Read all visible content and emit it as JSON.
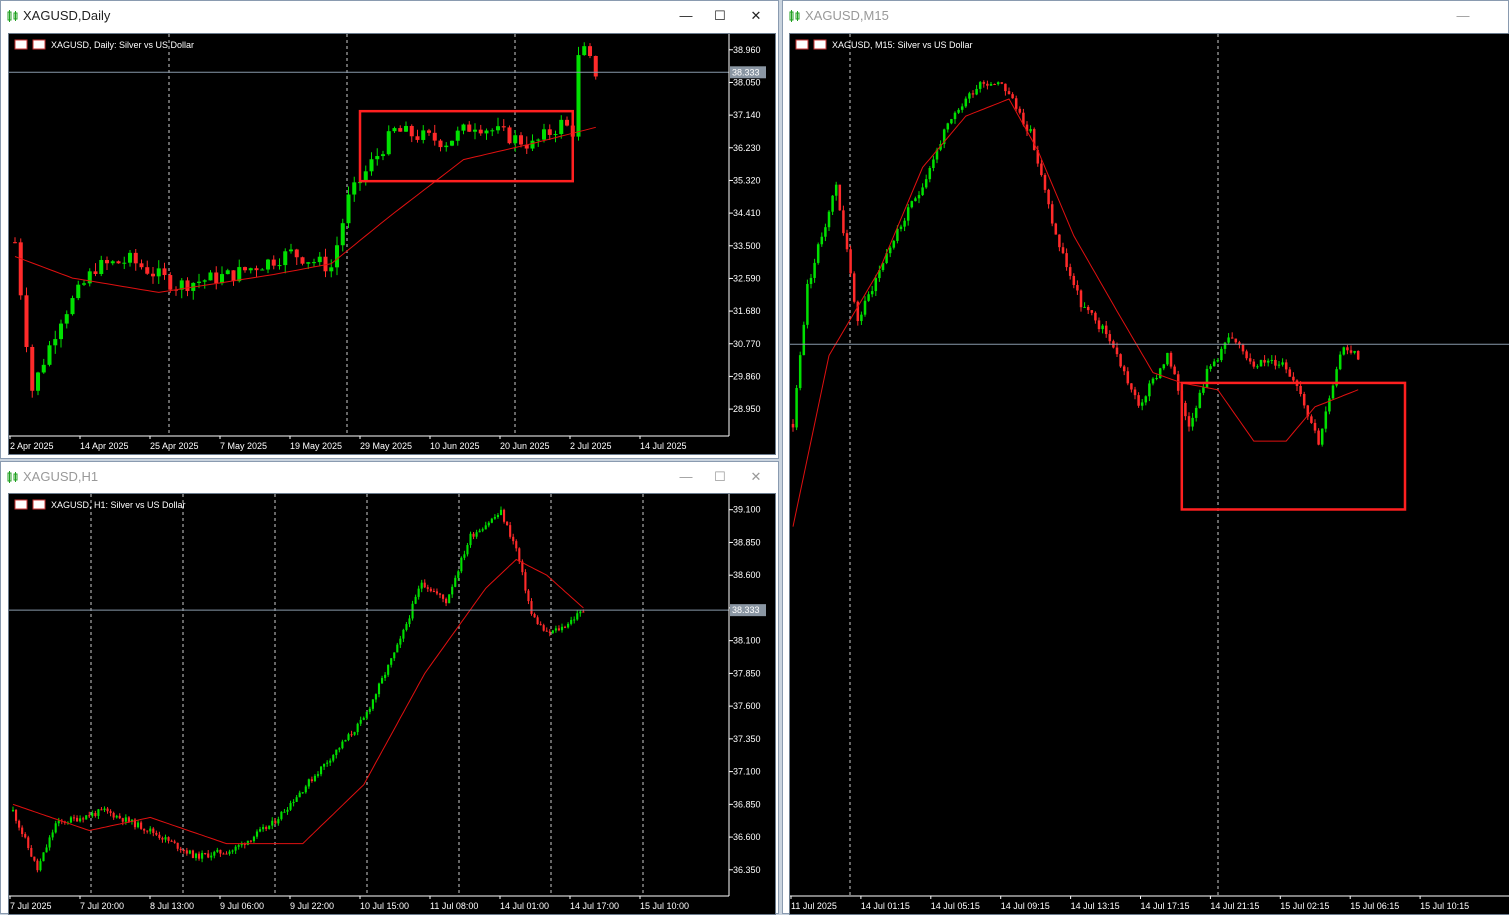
{
  "windows": [
    {
      "title": "XAGUSD,Daily",
      "legend": "XAGUSD, Daily:  Silver vs US Dollar",
      "active": true,
      "buttons": {
        "minimize": "—",
        "maximize": "☐",
        "close": "✕"
      }
    },
    {
      "title": "XAGUSD,H1",
      "legend": "XAGUSD, H1:  Silver vs US Dollar",
      "active": false,
      "buttons": {
        "minimize": "—",
        "maximize": "☐",
        "close": "✕"
      }
    },
    {
      "title": "XAGUSD,M15",
      "legend": "XAGUSD, M15:  Silver vs US Dollar",
      "active": false,
      "buttons": {
        "minimize": "—",
        "maximize": "☐",
        "close": "✕"
      }
    }
  ],
  "colors": {
    "up": "#00e000",
    "down": "#ff2a2a",
    "ma": "#e01010",
    "grid": "#ffffff",
    "price_line": "#8899aa",
    "box": "#ff2020",
    "axis_text": "#ffffff",
    "price_label_bg": "#8a96a3"
  },
  "chart_data": [
    {
      "type": "candlestick",
      "symbol": "XAGUSD",
      "timeframe": "Daily",
      "ylim": [
        28.2,
        39.4
      ],
      "yticks": [
        "38.960",
        "38.050",
        "37.140",
        "36.230",
        "35.320",
        "34.410",
        "33.500",
        "32.590",
        "31.680",
        "30.770",
        "29.860",
        "28.950"
      ],
      "xticks": [
        "2 Apr 2025",
        "14 Apr 2025",
        "25 Apr 2025",
        "7 May 2025",
        "19 May 2025",
        "29 May 2025",
        "10 Jun 2025",
        "20 Jun 2025",
        "2 Jul 2025",
        "14 Jul 2025"
      ],
      "current_price": "38.333",
      "highlight_box": {
        "x_from": 60,
        "x_to": 97,
        "price_from": 35.3,
        "price_to": 37.25
      },
      "ohlc_keypoints": [
        [
          0,
          33.6
        ],
        [
          3,
          29.5
        ],
        [
          8,
          31.5
        ],
        [
          14,
          32.9
        ],
        [
          20,
          33.1
        ],
        [
          28,
          32.4
        ],
        [
          38,
          32.7
        ],
        [
          48,
          33.3
        ],
        [
          55,
          32.9
        ],
        [
          58,
          34.8
        ],
        [
          62,
          35.8
        ],
        [
          66,
          36.7
        ],
        [
          75,
          36.4
        ],
        [
          80,
          36.9
        ],
        [
          90,
          36.3
        ],
        [
          95,
          36.9
        ],
        [
          97,
          36.7
        ],
        [
          98,
          38.7
        ],
        [
          99,
          38.9
        ],
        [
          101,
          38.33
        ]
      ],
      "moving_average_keypoints": [
        [
          0,
          33.2
        ],
        [
          10,
          32.6
        ],
        [
          25,
          32.2
        ],
        [
          45,
          32.7
        ],
        [
          55,
          33.0
        ],
        [
          65,
          34.3
        ],
        [
          78,
          35.9
        ],
        [
          90,
          36.35
        ],
        [
          101,
          36.8
        ]
      ]
    },
    {
      "type": "candlestick",
      "symbol": "XAGUSD",
      "timeframe": "H1",
      "ylim": [
        36.15,
        39.22
      ],
      "yticks": [
        "39.100",
        "38.850",
        "38.600",
        "38.350",
        "38.100",
        "37.850",
        "37.600",
        "37.350",
        "37.100",
        "36.850",
        "36.600",
        "36.350"
      ],
      "xticks": [
        "7 Jul 2025",
        "7 Jul 20:00",
        "8 Jul 13:00",
        "9 Jul 06:00",
        "9 Jul 22:00",
        "10 Jul 15:00",
        "11 Jul 08:00",
        "14 Jul 01:00",
        "14 Jul 17:00",
        "15 Jul 10:00"
      ],
      "current_price": "38.333",
      "ohlc_keypoints": [
        [
          0,
          36.8
        ],
        [
          8,
          36.35
        ],
        [
          14,
          36.7
        ],
        [
          30,
          36.8
        ],
        [
          45,
          36.65
        ],
        [
          60,
          36.45
        ],
        [
          72,
          36.5
        ],
        [
          85,
          36.7
        ],
        [
          100,
          37.1
        ],
        [
          115,
          37.5
        ],
        [
          127,
          38.1
        ],
        [
          134,
          38.55
        ],
        [
          142,
          38.4
        ],
        [
          150,
          38.9
        ],
        [
          160,
          39.08
        ],
        [
          165,
          38.8
        ],
        [
          170,
          38.3
        ],
        [
          175,
          38.15
        ],
        [
          180,
          38.2
        ],
        [
          187,
          38.33
        ]
      ],
      "moving_average_keypoints": [
        [
          0,
          36.85
        ],
        [
          25,
          36.65
        ],
        [
          45,
          36.75
        ],
        [
          70,
          36.55
        ],
        [
          95,
          36.55
        ],
        [
          115,
          37.0
        ],
        [
          135,
          37.85
        ],
        [
          155,
          38.5
        ],
        [
          165,
          38.72
        ],
        [
          175,
          38.6
        ],
        [
          187,
          38.35
        ]
      ]
    },
    {
      "type": "candlestick",
      "symbol": "XAGUSD",
      "timeframe": "M15",
      "ylim": [
        36.72,
        39.24
      ],
      "yticks": [],
      "xticks": [
        "11 Jul 2025",
        "14 Jul 01:15",
        "14 Jul 05:15",
        "14 Jul 09:15",
        "14 Jul 13:15",
        "14 Jul 17:15",
        "14 Jul 21:15",
        "15 Jul 02:15",
        "15 Jul 06:15",
        "15 Jul 10:15"
      ],
      "current_price": "38.333",
      "highlight_box": {
        "x_from": 108,
        "x_to": 170,
        "price_from": 37.85,
        "price_to": 38.22
      },
      "ohlc_keypoints": [
        [
          0,
          38.1
        ],
        [
          4,
          38.5
        ],
        [
          12,
          38.8
        ],
        [
          18,
          38.4
        ],
        [
          26,
          38.6
        ],
        [
          36,
          38.8
        ],
        [
          42,
          38.95
        ],
        [
          48,
          39.05
        ],
        [
          52,
          39.1
        ],
        [
          58,
          39.1
        ],
        [
          66,
          38.95
        ],
        [
          73,
          38.65
        ],
        [
          80,
          38.45
        ],
        [
          88,
          38.35
        ],
        [
          96,
          38.15
        ],
        [
          104,
          38.3
        ],
        [
          110,
          38.1
        ],
        [
          115,
          38.25
        ],
        [
          121,
          38.35
        ],
        [
          128,
          38.28
        ],
        [
          136,
          38.28
        ],
        [
          140,
          38.22
        ],
        [
          146,
          38.05
        ],
        [
          153,
          38.33
        ],
        [
          157,
          38.3
        ]
      ],
      "moving_average_keypoints": [
        [
          0,
          37.8
        ],
        [
          10,
          38.3
        ],
        [
          24,
          38.55
        ],
        [
          36,
          38.85
        ],
        [
          48,
          39.0
        ],
        [
          60,
          39.05
        ],
        [
          68,
          38.9
        ],
        [
          78,
          38.65
        ],
        [
          90,
          38.43
        ],
        [
          100,
          38.25
        ],
        [
          108,
          38.22
        ],
        [
          118,
          38.2
        ],
        [
          128,
          38.05
        ],
        [
          137,
          38.05
        ],
        [
          145,
          38.15
        ],
        [
          157,
          38.2
        ]
      ]
    }
  ]
}
